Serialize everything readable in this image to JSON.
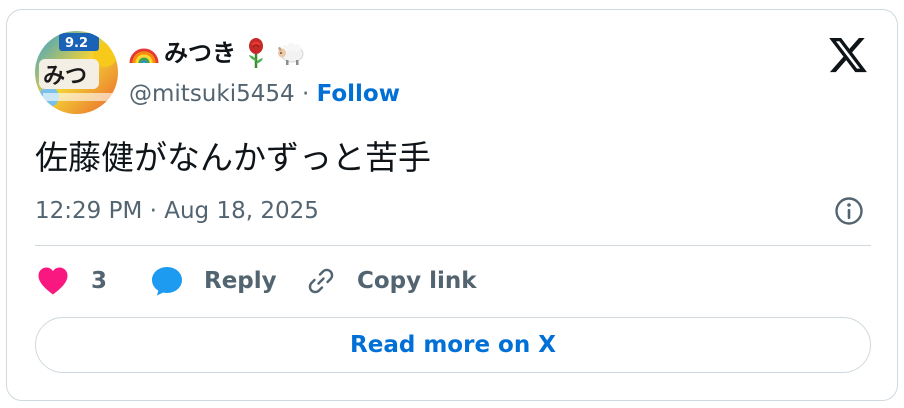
{
  "author": {
    "display_name": "みつき",
    "handle": "@mitsuki5454",
    "separator": "·",
    "follow_label": "Follow",
    "name_emojis": [
      "rainbow-emoji",
      "rose-emoji",
      "sheep-emoji"
    ],
    "avatar_text": "みつ",
    "avatar_badge": "9.2"
  },
  "tweet": {
    "text": "佐藤健がなんかずっと苦手",
    "timestamp": "12:29 PM · Aug 18, 2025"
  },
  "actions": {
    "like_count": "3",
    "reply_label": "Reply",
    "copy_link_label": "Copy link"
  },
  "read_more_label": "Read more on X",
  "icons": {
    "logo": "x-logo-icon",
    "info": "info-icon",
    "like": "heart-icon",
    "reply": "speech-bubble-icon",
    "copy": "link-icon"
  },
  "colors": {
    "text_primary": "#0f1419",
    "text_secondary": "#536471",
    "link_blue": "#006fd6",
    "like_pink": "#f91880",
    "reply_blue": "#1d9bf0",
    "border": "#cfd9de"
  }
}
